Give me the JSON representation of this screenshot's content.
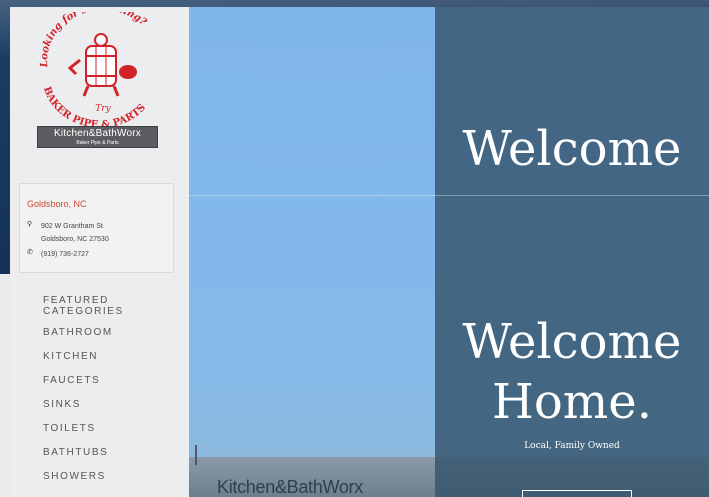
{
  "logo": {
    "top_text": "Looking for something?",
    "try_text": "Try",
    "bottom_text": "BAKER PIPE & PARTS",
    "red": "#d2232a"
  },
  "brand_badge": {
    "name": "Kitchen&BathWorx",
    "sub": "Baker Pipe & Parts"
  },
  "location": {
    "title": "Goldsboro, NC",
    "address_line1": "902 W Grantham St",
    "address_line2": "Goldsboro, NC 27530",
    "phone": "(919) 736-2727",
    "pin_icon": "map-pin-icon",
    "phone_icon": "phone-icon",
    "accent": "#d2482c"
  },
  "menu": {
    "heading_line1": "FEATURED",
    "heading_line2": "CATEGORIES",
    "items": [
      "BATHROOM",
      "KITCHEN",
      "FAUCETS",
      "SINKS",
      "TOILETS",
      "BATHTUBS",
      "SHOWERS"
    ]
  },
  "hero": {
    "welcome_top": "Welcome",
    "welcome_line1": "Welcome",
    "welcome_line2": "Home.",
    "tagline": "Local, Family Owned",
    "building_sign": "Kitchen&BathWorx"
  }
}
